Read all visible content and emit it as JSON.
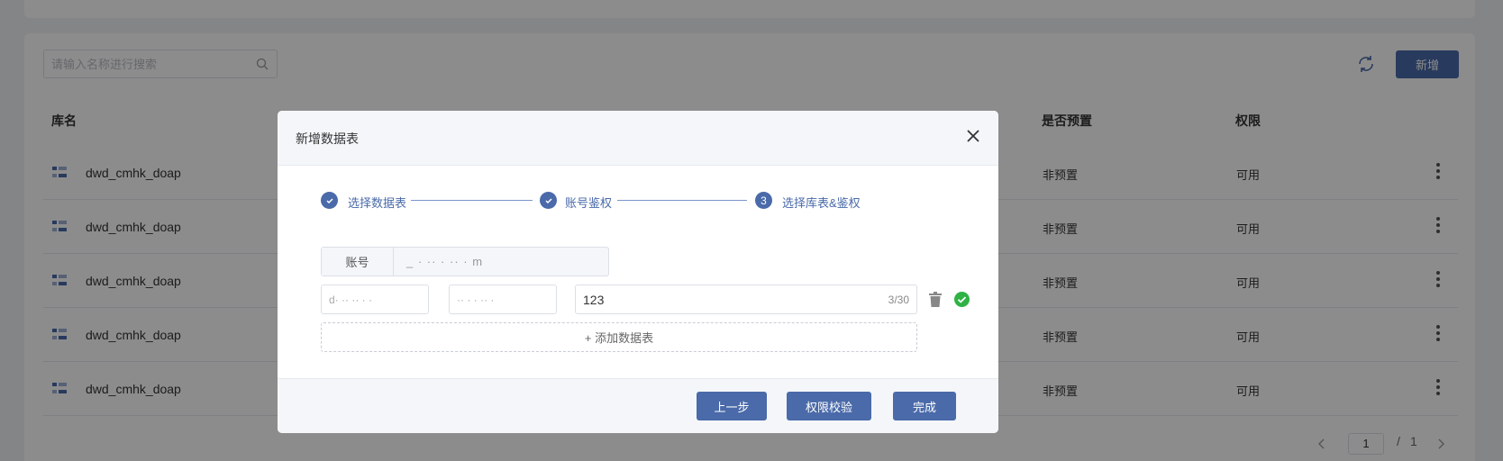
{
  "search": {
    "placeholder": "请输入名称进行搜索"
  },
  "toolbar": {
    "new_label": "新增"
  },
  "table": {
    "headers": {
      "db_name": "库名",
      "preset": "是否预置",
      "permission": "权限"
    },
    "rows": [
      {
        "name": "dwd_cmhk_doap",
        "preset": "非预置",
        "permission": "可用"
      },
      {
        "name": "dwd_cmhk_doap",
        "preset": "非预置",
        "permission": "可用"
      },
      {
        "name": "dwd_cmhk_doap",
        "preset": "非预置",
        "permission": "可用"
      },
      {
        "name": "dwd_cmhk_doap",
        "preset": "非预置",
        "permission": "可用"
      },
      {
        "name": "dwd_cmhk_doap",
        "preset": "非预置",
        "permission": "可用"
      }
    ]
  },
  "pagination": {
    "current": "1",
    "separator": "/",
    "total": "1"
  },
  "modal": {
    "title": "新增数据表",
    "steps": [
      {
        "number": "1",
        "label": "选择数据表",
        "status": "done"
      },
      {
        "number": "2",
        "label": "账号鉴权",
        "status": "done"
      },
      {
        "number": "3",
        "label": "选择库表&鉴权",
        "status": "active"
      }
    ],
    "account": {
      "label": "账号",
      "value": "_ ·  ·· ·  ··  ·  m"
    },
    "db_select": {
      "value": "d·  ··  ··  · ·"
    },
    "schema_select": {
      "value": "··  · ·  ··  ·"
    },
    "table_input": {
      "value": "123",
      "count": "3/30"
    },
    "add_table_label": "+ 添加数据表",
    "footer": {
      "prev_label": "上一步",
      "verify_label": "权限校验",
      "finish_label": "完成"
    }
  },
  "colors": {
    "primary": "#4a6aa9",
    "success": "#2fb344",
    "mask": "rgba(0,0,0,0.45)"
  }
}
